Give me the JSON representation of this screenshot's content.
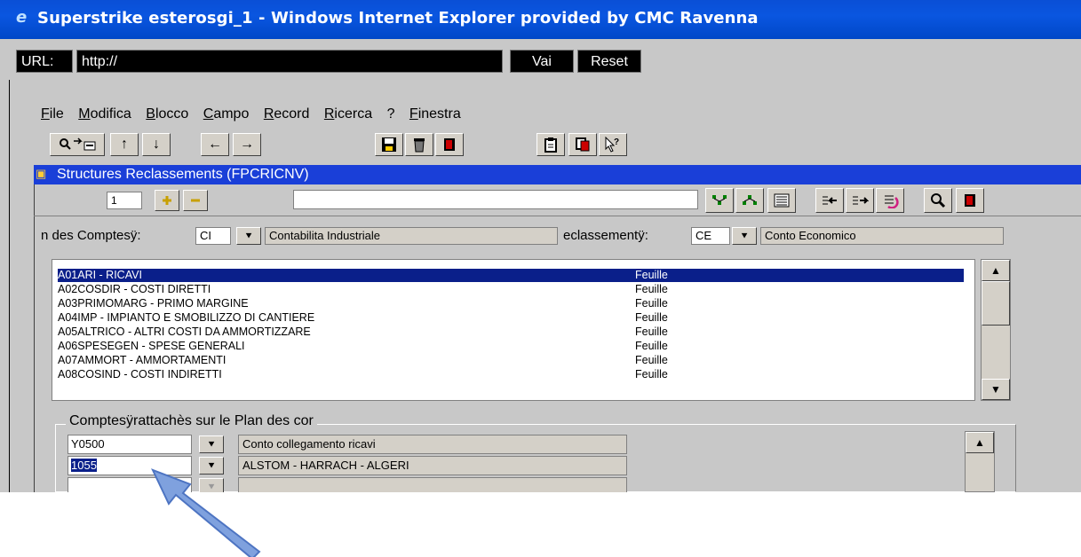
{
  "window": {
    "title": "Superstrike esterosgi_1 - Windows Internet Explorer provided by CMC Ravenna",
    "icon": "ie-icon"
  },
  "urlbar": {
    "label": "URL:",
    "value": "http://",
    "go_label": "Vai",
    "reset_label": "Reset"
  },
  "menu": {
    "items": [
      {
        "label": "File",
        "u": "F",
        "rest": "ile"
      },
      {
        "label": "Modifica",
        "u": "M",
        "rest": "odifica"
      },
      {
        "label": "Blocco",
        "u": "B",
        "rest": "locco"
      },
      {
        "label": "Campo",
        "u": "C",
        "rest": "ampo"
      },
      {
        "label": "Record",
        "u": "R",
        "rest": "ecord"
      },
      {
        "label": "Ricerca",
        "u": "R",
        "rest": "icerca"
      },
      {
        "label": "?",
        "u": "",
        "rest": "?"
      },
      {
        "label": "Finestra",
        "u": "F",
        "rest": "inestra"
      }
    ]
  },
  "form": {
    "title": "Structures Reclassements (FPCRICNV)",
    "record_number": "1",
    "field1": {
      "label": "n des Comptesÿ:",
      "code": "CI",
      "description": "Contabilita Industriale"
    },
    "field2": {
      "label": "eclassementÿ:",
      "code": "CE",
      "description": "Conto Economico"
    },
    "list": {
      "rows": [
        {
          "name": "A01ARI - RICAVI",
          "type": "Feuille",
          "selected": true
        },
        {
          "name": "A02COSDIR - COSTI DIRETTI",
          "type": "Feuille"
        },
        {
          "name": "A03PRIMOMARG - PRIMO MARGINE",
          "type": "Feuille"
        },
        {
          "name": "A04IMP - IMPIANTO E SMOBILIZZO DI CANTIERE",
          "type": "Feuille"
        },
        {
          "name": "A05ALTRICO - ALTRI COSTI DA AMMORTIZZARE",
          "type": "Feuille"
        },
        {
          "name": "A06SPESEGEN - SPESE GENERALI",
          "type": "Feuille"
        },
        {
          "name": "A07AMMORT - AMMORTAMENTI",
          "type": "Feuille"
        },
        {
          "name": "A08COSIND - COSTI INDIRETTI",
          "type": "Feuille"
        }
      ]
    },
    "group": {
      "title": "Comptesÿrattachès sur le Plan des cor",
      "rows": [
        {
          "code": "Y0500",
          "description": "Conto collegamento ricavi"
        },
        {
          "code": "1055",
          "description": "ALSTOM - HARRACH - ALGERI"
        },
        {
          "code": "",
          "description": ""
        }
      ]
    }
  },
  "colors": {
    "titlebar": "#0a56e0",
    "selection": "#0a1f8a",
    "arrow": "#6f94d6"
  }
}
